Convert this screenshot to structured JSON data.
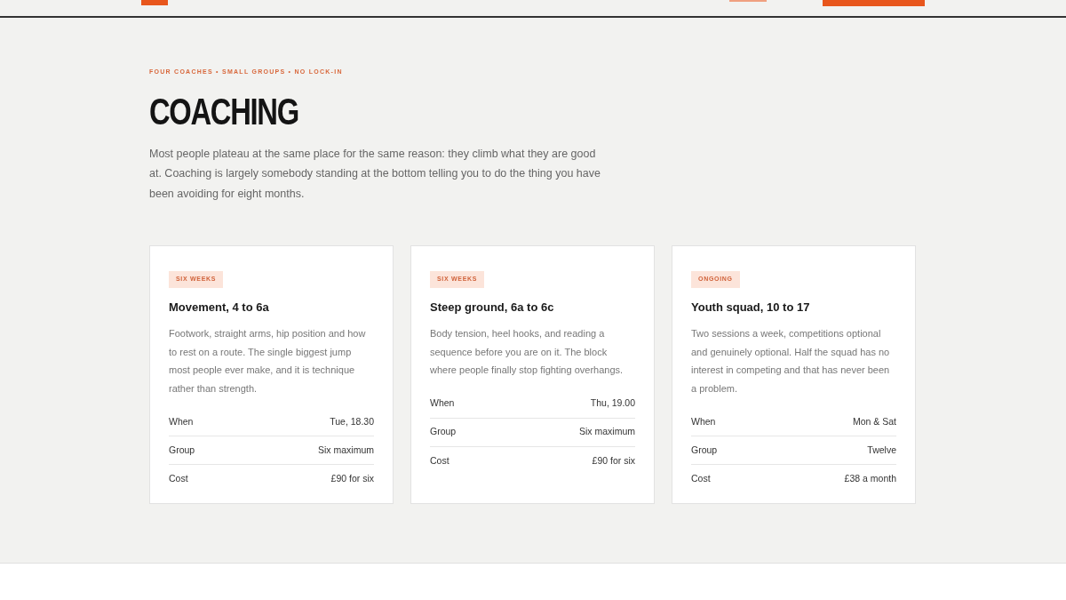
{
  "eyebrow": "FOUR COACHES • SMALL GROUPS • NO LOCK-IN",
  "title": "COACHING",
  "intro": "Most people plateau at the same place for the same reason: they climb what they are good at. Coaching is largely somebody standing at the bottom telling you to do the thing you have been avoiding for eight months.",
  "cards": [
    {
      "tag": "SIX WEEKS",
      "title": "Movement, 4 to 6a",
      "description": "Footwork, straight arms, hip position and how to rest on a route. The single biggest jump most people ever make, and it is technique rather than strength.",
      "details": [
        {
          "label": "When",
          "value": "Tue, 18.30"
        },
        {
          "label": "Group",
          "value": "Six maximum"
        },
        {
          "label": "Cost",
          "value": "£90 for six"
        }
      ]
    },
    {
      "tag": "SIX WEEKS",
      "title": "Steep ground, 6a to 6c",
      "description": "Body tension, heel hooks, and reading a sequence before you are on it. The block where people finally stop fighting overhangs.",
      "details": [
        {
          "label": "When",
          "value": "Thu, 19.00"
        },
        {
          "label": "Group",
          "value": "Six maximum"
        },
        {
          "label": "Cost",
          "value": "£90 for six"
        }
      ]
    },
    {
      "tag": "ONGOING",
      "title": "Youth squad, 10 to 17",
      "description": "Two sessions a week, competitions optional and genuinely optional. Half the squad has no interest in competing and that has never been a problem.",
      "details": [
        {
          "label": "When",
          "value": "Mon & Sat"
        },
        {
          "label": "Group",
          "value": "Twelve"
        },
        {
          "label": "Cost",
          "value": "£38 a month"
        }
      ]
    }
  ]
}
